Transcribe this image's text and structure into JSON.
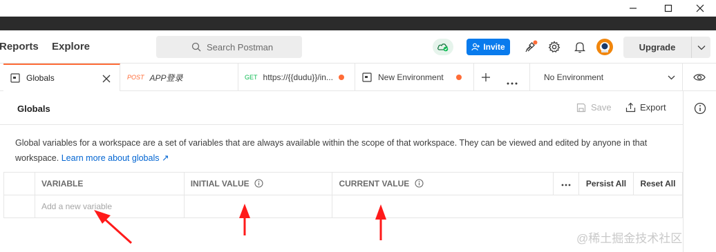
{
  "window": {
    "minimize_icon": "minimize-icon",
    "maximize_icon": "maximize-icon",
    "close_icon": "close-icon"
  },
  "header": {
    "nav": [
      "Reports",
      "Explore"
    ],
    "search_placeholder": "Search Postman",
    "invite_label": "Invite",
    "upgrade_label": "Upgrade"
  },
  "tabs": [
    {
      "label": "Globals",
      "active": true
    },
    {
      "method": "POST",
      "label": "APP登录",
      "method_color": "#ff6c37"
    },
    {
      "method": "GET",
      "label": "https://{{dudu}}/in...",
      "method_color": "#0cbb52"
    },
    {
      "label": "New Environment"
    }
  ],
  "environment": {
    "selected": "No Environment"
  },
  "content": {
    "title": "Globals",
    "save_label": "Save",
    "export_label": "Export",
    "description": "Global variables for a workspace are a set of variables that are always available within the scope of that workspace. They can be viewed and edited by anyone in that workspace.",
    "learn_more": "Learn more about globals ↗"
  },
  "table": {
    "headers": [
      "VARIABLE",
      "INITIAL VALUE",
      "CURRENT VALUE",
      "Persist All",
      "Reset All"
    ],
    "new_row_placeholder": "Add a new variable"
  },
  "watermark": "@稀土掘金技术社区",
  "colors": {
    "accent": "#ff6c37",
    "invite": "#097bed",
    "annotation": "#ff1a1a"
  }
}
